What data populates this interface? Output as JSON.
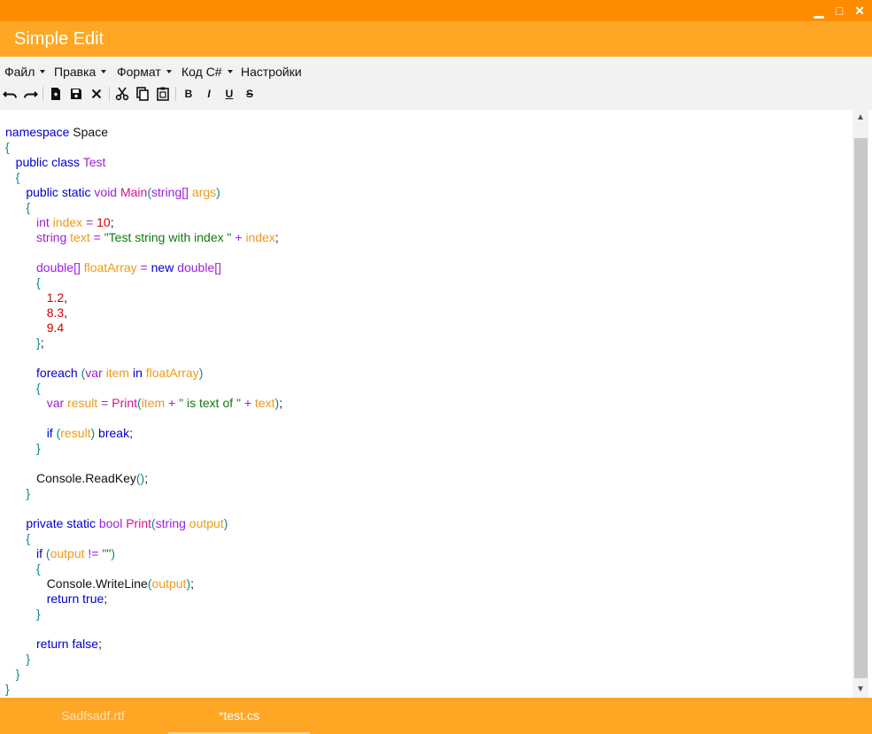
{
  "window": {
    "minimize_glyph": "▁",
    "maximize_glyph": "□",
    "close_glyph": "✕"
  },
  "app": {
    "title": "Simple Edit"
  },
  "menu": {
    "items": [
      {
        "label": "Файл",
        "has_dropdown": true
      },
      {
        "label": "Правка",
        "has_dropdown": true
      },
      {
        "label": "Формат",
        "has_dropdown": true
      },
      {
        "label": "Код C#",
        "has_dropdown": true
      },
      {
        "label": "Настройки",
        "has_dropdown": false
      }
    ]
  },
  "toolbar": {
    "icons": [
      "undo-icon",
      "redo-icon",
      "new-file-icon",
      "save-icon",
      "close-icon",
      "cut-icon",
      "copy-icon",
      "paste-icon",
      "bold-icon",
      "italic-icon",
      "underline-icon",
      "strikethrough-icon"
    ],
    "bold_label": "B",
    "italic_label": "I",
    "underline_label": "U",
    "strike_label": "S"
  },
  "editor": {
    "lines": [
      "namespace Space",
      "{",
      "   public class Test",
      "   {",
      "      public static void Main(string[] args)",
      "      {",
      "         int index = 10;",
      "         string text = \"Test string with index \" + index;",
      "",
      "         double[] floatArray = new double[]",
      "         {",
      "            1.2,",
      "            8.3,",
      "            9.4",
      "         };",
      "",
      "         foreach (var item in floatArray)",
      "         {",
      "            var result = Print(item + \" is text of \" + text);",
      "",
      "            if (result) break;",
      "         }",
      "",
      "         Console.ReadKey();",
      "      }",
      "",
      "      private static bool Print(string output)",
      "      {",
      "         if (output != \"\")",
      "         {",
      "            Console.WriteLine(output);",
      "            return true;",
      "         }",
      "",
      "         return false;",
      "      }",
      "   }",
      "}"
    ],
    "colors": {
      "keyword": "#0000cc",
      "type": "#9c1fd6",
      "function": "#d3128c",
      "variable": "#f09a16",
      "number": "#d40000",
      "string": "#0f7a0f",
      "punctuation": "#0b8a8a"
    }
  },
  "tabs": [
    {
      "label": "Sadfsadf.rtf",
      "active": false
    },
    {
      "label": "*test.cs",
      "active": true
    }
  ],
  "theme": {
    "accent_dark": "#ff8c00",
    "accent": "#ffa724"
  }
}
